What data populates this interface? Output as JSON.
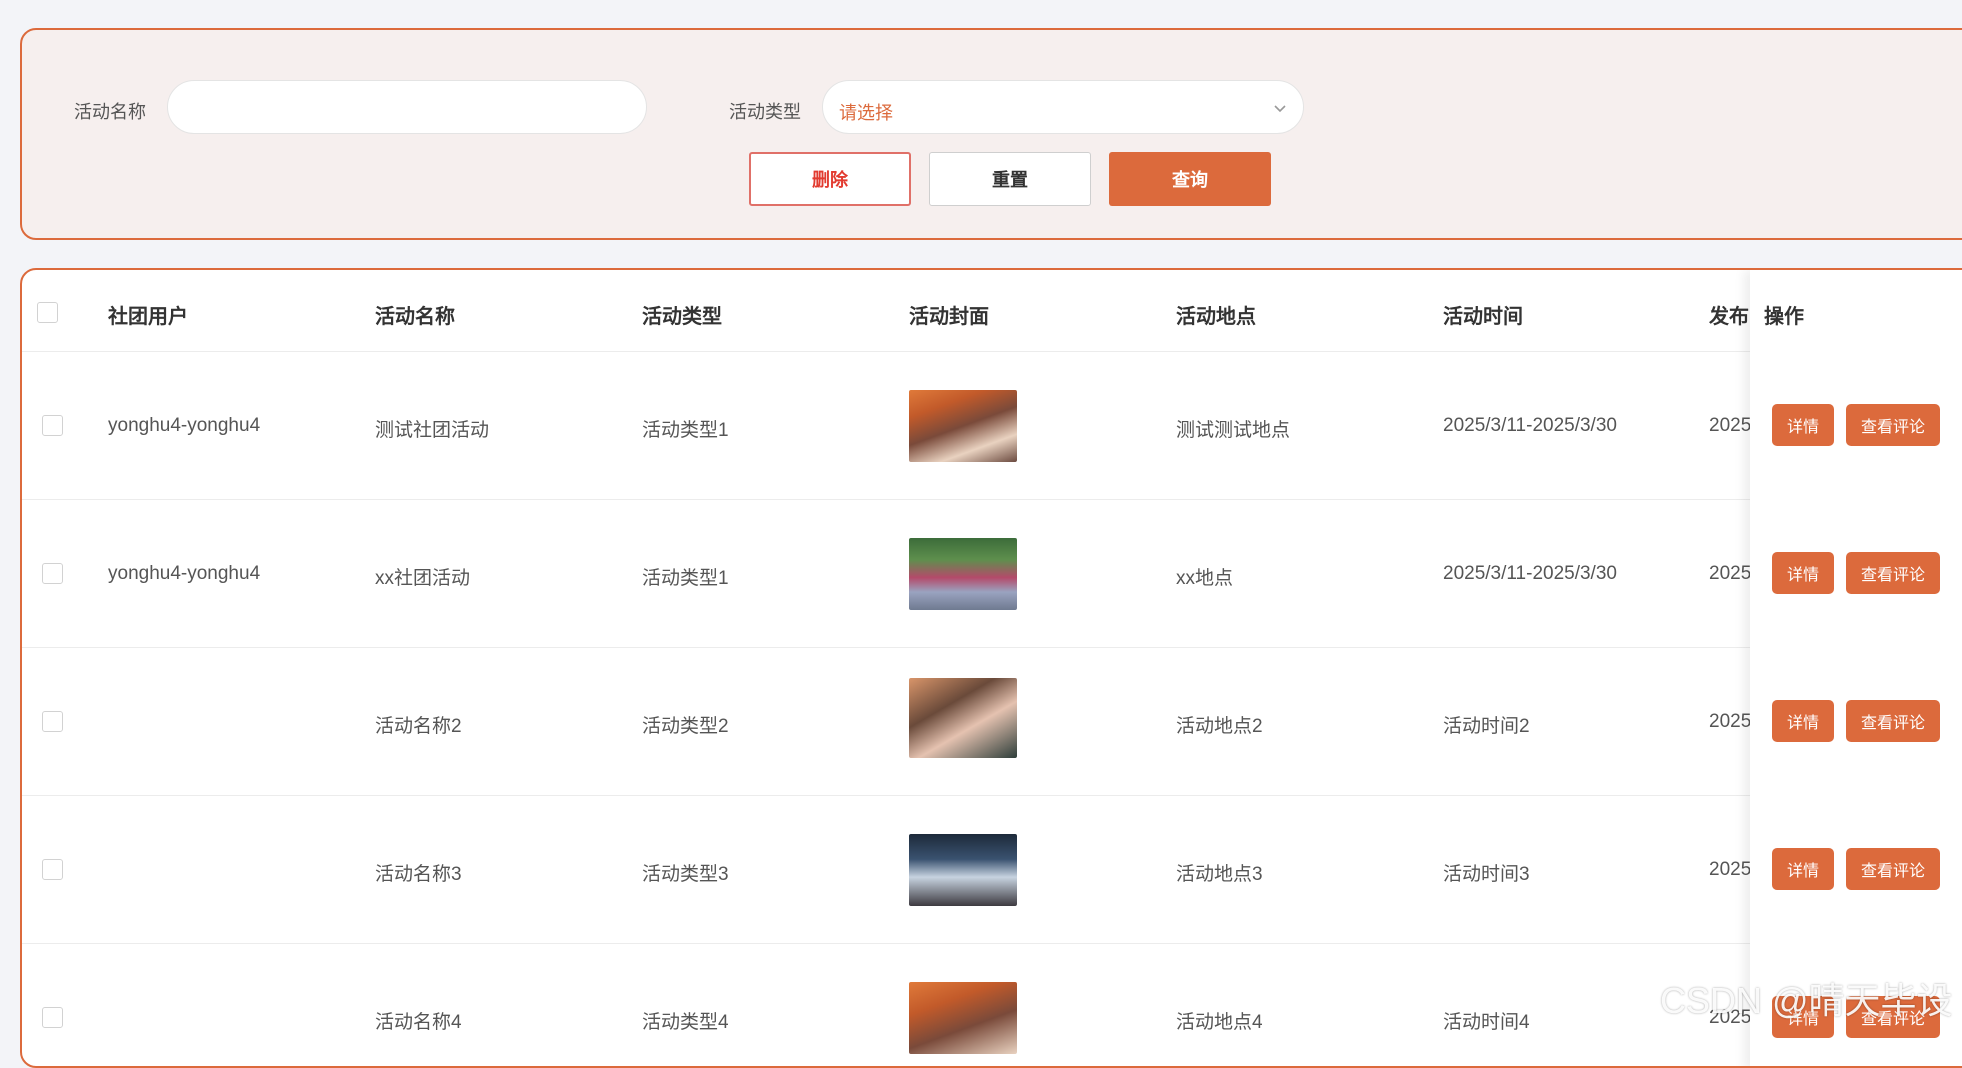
{
  "search": {
    "name_label": "活动名称",
    "name_value": "",
    "type_label": "活动类型",
    "type_placeholder": "请选择",
    "delete_label": "删除",
    "reset_label": "重置",
    "query_label": "查询"
  },
  "table": {
    "headers": [
      "社团用户",
      "活动名称",
      "活动类型",
      "活动封面",
      "活动地点",
      "活动时间",
      "发布",
      "操作"
    ],
    "rows": [
      {
        "user": "yonghu4-yonghu4",
        "name": "测试社团活动",
        "type": "活动类型1",
        "place": "测试测试地点",
        "time": "2025/3/11-2025/3/30",
        "publish": "2025"
      },
      {
        "user": "yonghu4-yonghu4",
        "name": "xx社团活动",
        "type": "活动类型1",
        "place": "xx地点",
        "time": "2025/3/11-2025/3/30",
        "publish": "2025"
      },
      {
        "user": "",
        "name": "活动名称2",
        "type": "活动类型2",
        "place": "活动地点2",
        "time": "活动时间2",
        "publish": "2025"
      },
      {
        "user": "",
        "name": "活动名称3",
        "type": "活动类型3",
        "place": "活动地点3",
        "time": "活动时间3",
        "publish": "2025"
      },
      {
        "user": "",
        "name": "活动名称4",
        "type": "活动类型4",
        "place": "活动地点4",
        "time": "活动时间4",
        "publish": "2025"
      }
    ],
    "detail_label": "详情",
    "comment_label": "查看评论"
  },
  "watermark": "CSDN @晴天毕设",
  "colors": {
    "accent": "#dc6a3c",
    "danger": "#e23b30",
    "page_bg": "#f3f4f8",
    "panel_bg": "#f6efee"
  },
  "icons": {
    "select_arrow": "chevron-down-icon"
  }
}
